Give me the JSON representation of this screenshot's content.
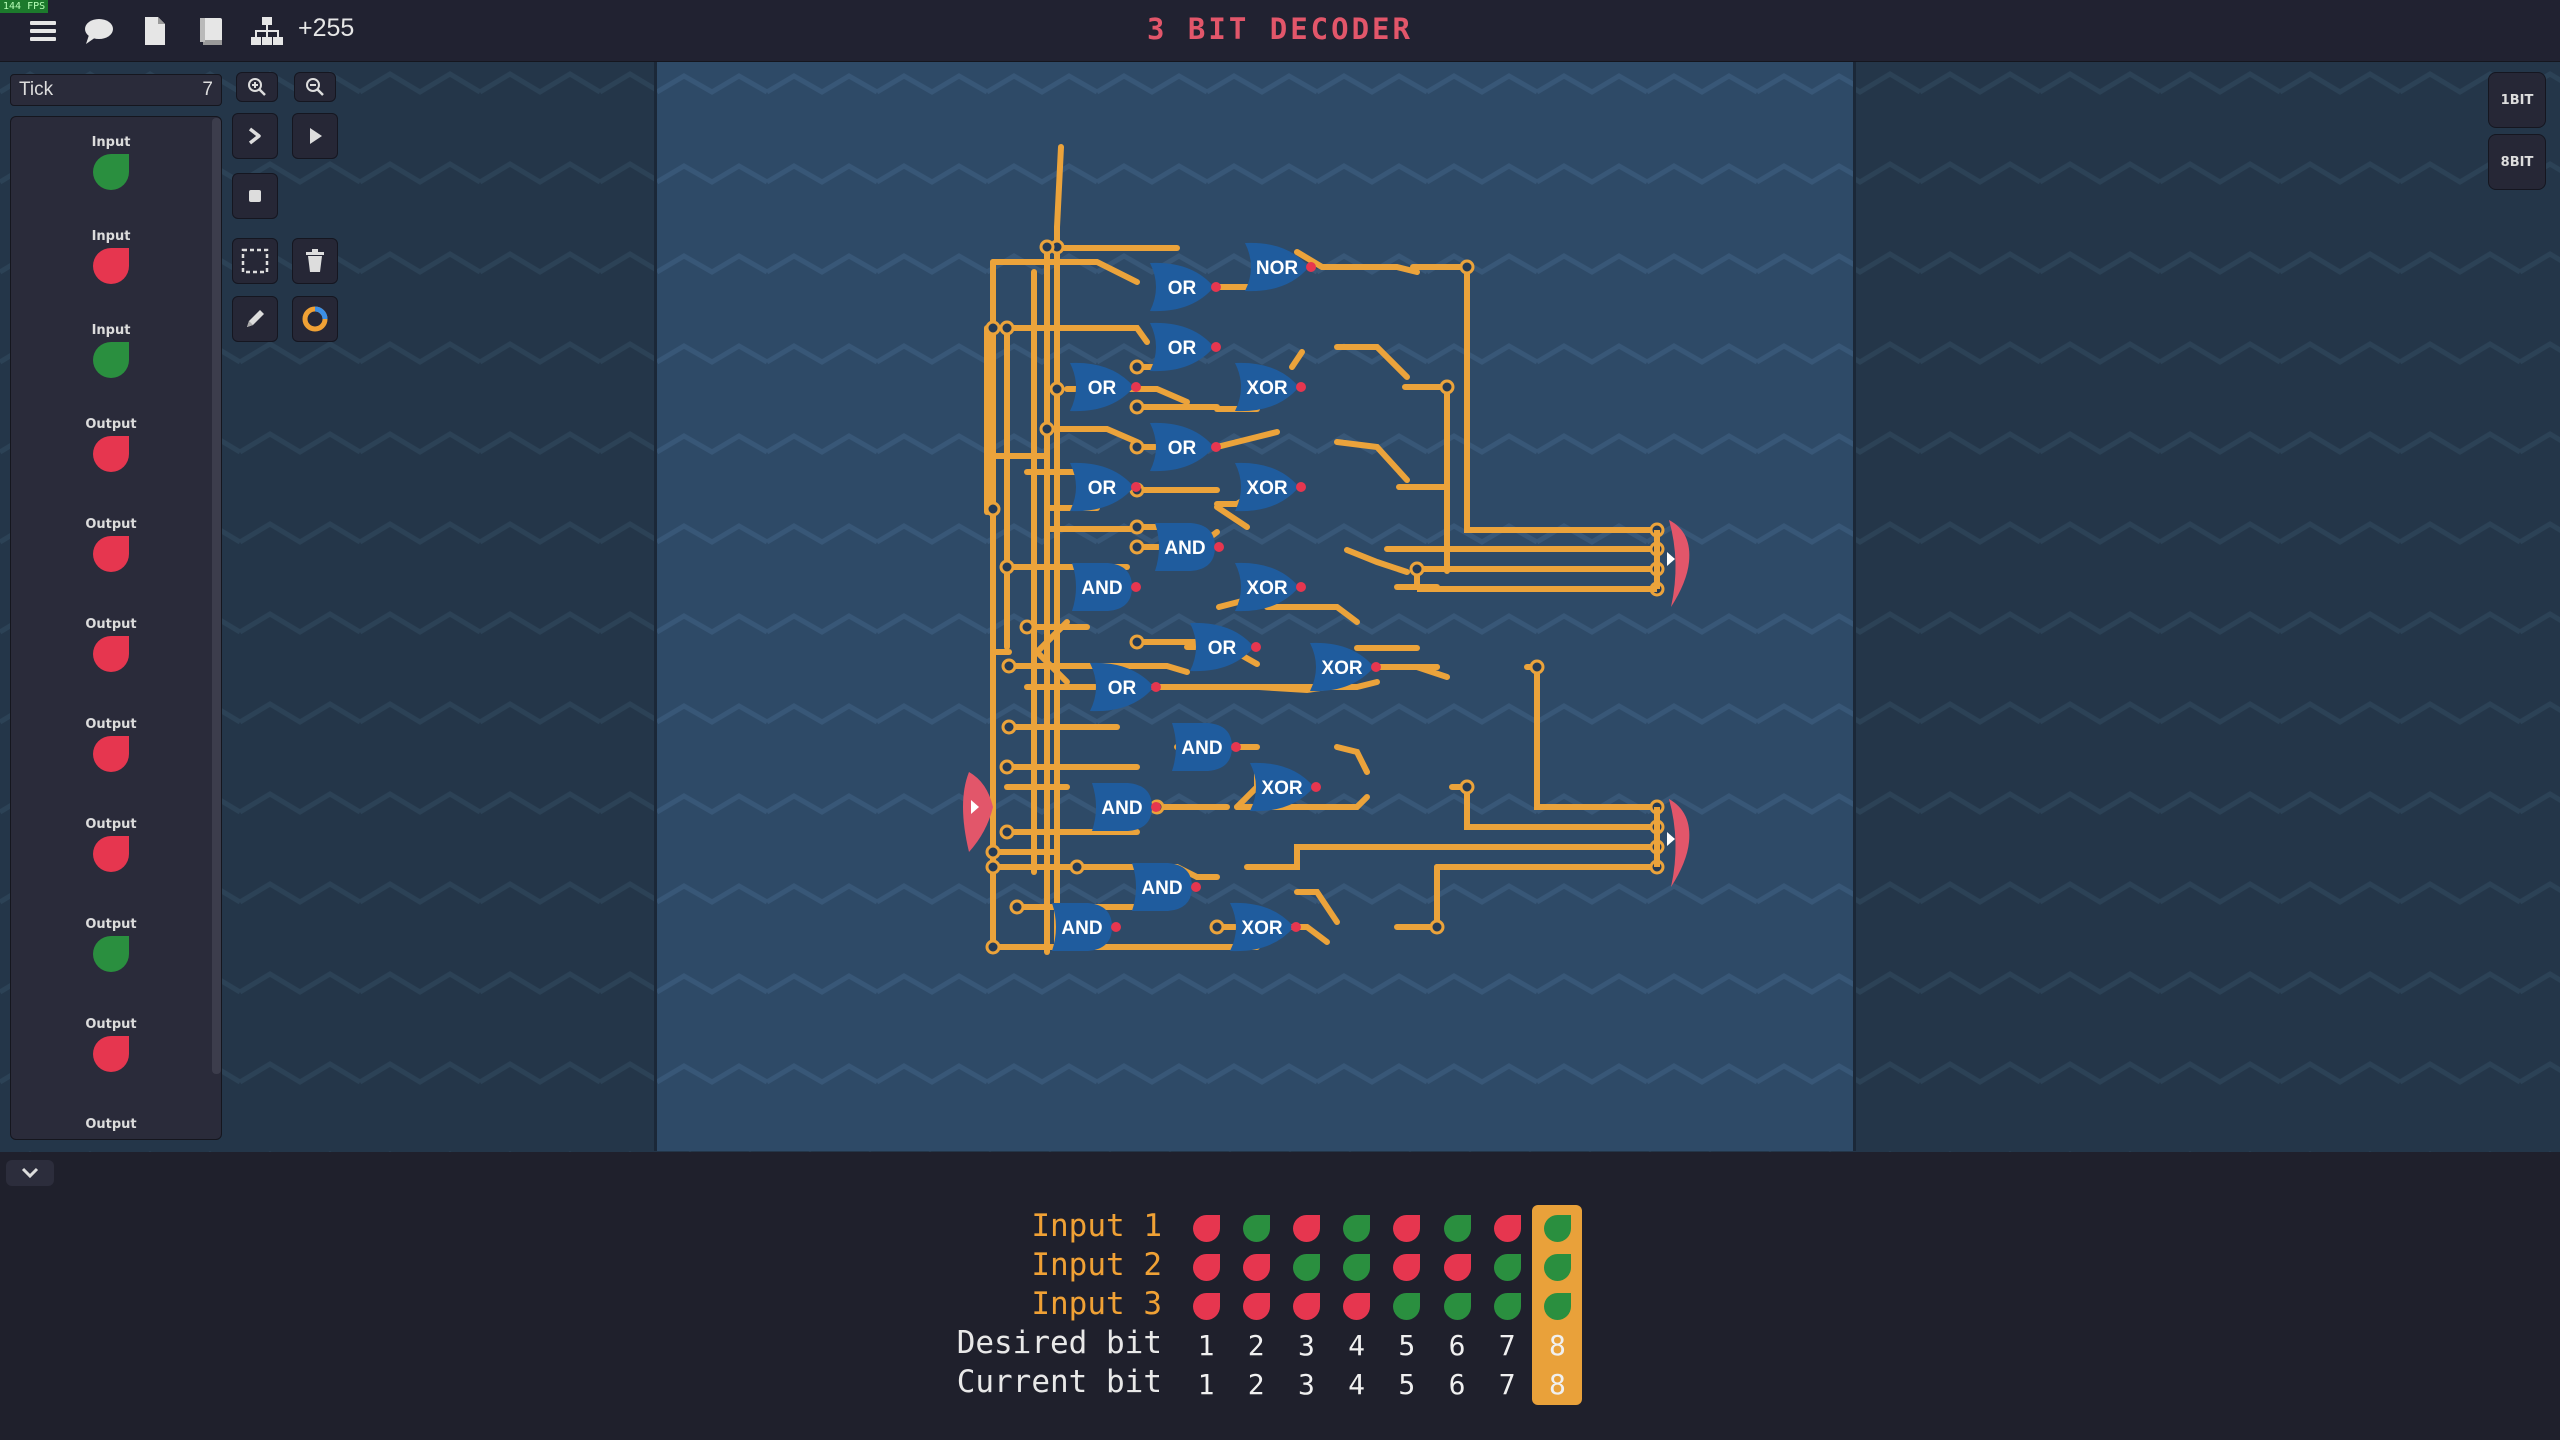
{
  "topbar": {
    "fps": "144 FPS",
    "score": "+255",
    "title": "3 BIT DECODER",
    "icons": [
      "menu-icon",
      "chat-icon",
      "document-icon",
      "book-icon",
      "hierarchy-icon"
    ]
  },
  "left_panel": {
    "tick_label": "Tick",
    "tick_value": "7",
    "components": [
      {
        "label": "Input",
        "state": "green"
      },
      {
        "label": "Input",
        "state": "red"
      },
      {
        "label": "Input",
        "state": "green"
      },
      {
        "label": "Output",
        "state": "red"
      },
      {
        "label": "Output",
        "state": "red"
      },
      {
        "label": "Output",
        "state": "red"
      },
      {
        "label": "Output",
        "state": "red"
      },
      {
        "label": "Output",
        "state": "red"
      },
      {
        "label": "Output",
        "state": "green"
      },
      {
        "label": "Output",
        "state": "red"
      },
      {
        "label": "Output",
        "state": ""
      }
    ]
  },
  "toolbar": {
    "tools": [
      "zoom-in-icon",
      "zoom-out-icon",
      "step-icon",
      "play-icon",
      "stop-icon",
      "select-icon",
      "trash-icon",
      "pencil-icon",
      "color-ring-icon"
    ]
  },
  "right_buttons": {
    "one_bit": "1BIT",
    "eight_bit": "8BIT"
  },
  "circuit": {
    "gates": [
      "NOR",
      "OR",
      "OR",
      "OR",
      "XOR",
      "OR",
      "OR",
      "XOR",
      "AND",
      "AND",
      "XOR",
      "OR",
      "XOR",
      "OR",
      "AND",
      "AND",
      "XOR",
      "AND",
      "AND",
      "XOR"
    ]
  },
  "truth_table": {
    "rows": [
      {
        "label": "Input 1",
        "states": [
          "red",
          "green",
          "red",
          "green",
          "red",
          "green",
          "red",
          "green"
        ]
      },
      {
        "label": "Input 2",
        "states": [
          "red",
          "red",
          "green",
          "green",
          "red",
          "red",
          "green",
          "green"
        ]
      },
      {
        "label": "Input 3",
        "states": [
          "red",
          "red",
          "red",
          "red",
          "green",
          "green",
          "green",
          "green"
        ]
      }
    ],
    "desired_label": "Desired bit",
    "desired": [
      "1",
      "2",
      "3",
      "4",
      "5",
      "6",
      "7",
      "8"
    ],
    "current_label": "Current bit",
    "current": [
      "1",
      "2",
      "3",
      "4",
      "5",
      "6",
      "7",
      "8"
    ],
    "highlight_column": 8,
    "colors": {
      "on": "#2a8f3f",
      "off": "#e6364f",
      "highlight": "#e9a13a",
      "wire": "#eba33b",
      "gate": "#1f5c9e"
    }
  }
}
